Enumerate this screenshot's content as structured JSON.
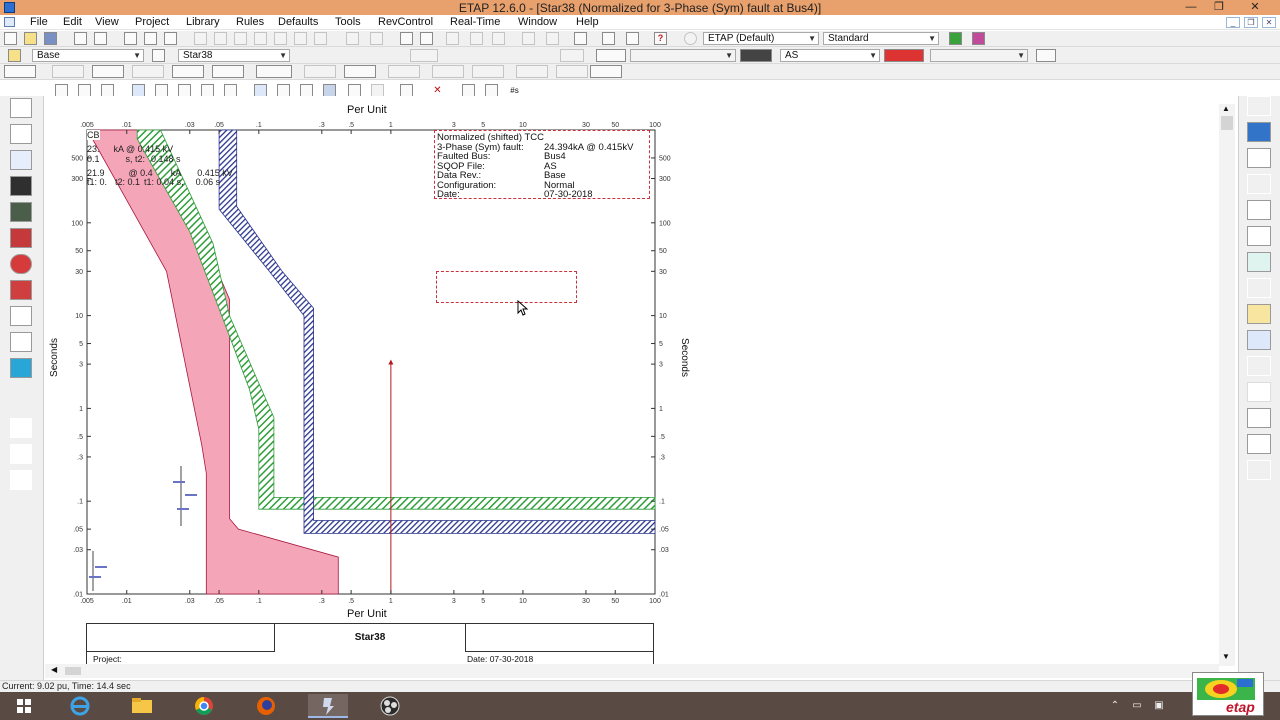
{
  "window": {
    "title": "ETAP 12.6.0 - [Star38 (Normalized for 3-Phase (Sym) fault at Bus4)]",
    "minimize": "—",
    "restore": "❐",
    "close": "✕"
  },
  "menu": {
    "items": [
      "File",
      "Edit",
      "View",
      "Project",
      "Library",
      "Rules",
      "Defaults",
      "Tools",
      "RevControl",
      "Real-Time",
      "Window",
      "Help"
    ]
  },
  "toolbar1": {
    "etap_combo": "ETAP (Default)",
    "standard_combo": "Standard"
  },
  "toolbar2": {
    "presentation_combo": "Base",
    "view_combo": "Star38",
    "bus_combo": "AS"
  },
  "plot": {
    "top_axis_label": "Per Unit",
    "bottom_axis_label": "Per Unit",
    "left_axis_label": "Seconds",
    "right_axis_label": "Seconds",
    "x_ticks": [
      ".005",
      ".01",
      ".03",
      ".05",
      ".1",
      ".3",
      ".5",
      "1",
      "3",
      "5",
      "10",
      "30",
      "50",
      "100"
    ],
    "y_ticks_left": [
      "500",
      "300",
      "100",
      "50",
      "30",
      "10",
      "5",
      "3",
      "1",
      ".5",
      ".3",
      ".1",
      ".05",
      ".03",
      ".01"
    ],
    "y_ticks_right": [
      "500",
      "300",
      "100",
      "50",
      "30",
      "10",
      "5",
      "3",
      "1",
      ".5",
      ".3",
      ".1",
      ".05",
      ".03",
      ".01"
    ],
    "colors": {
      "pink_band": "#f4a5b8",
      "pink_edge": "#a8163f",
      "green_band": "#2f9e3a",
      "blue_band": "#29348c",
      "fault_line": "#b4191e",
      "info_border": "#c8323c"
    },
    "overlay_text": {
      "line1": "CB",
      "line2": "23.",
      "line2b": "kA @ 0.415 kV",
      "line3": "0.1",
      "line3b": "s, t2:",
      "line3c": "0.148 s",
      "line4": "21.9",
      "line4b": "@ 0.4",
      "line4c": "kA",
      "line4d": "0.415 kV",
      "line5": "t1: 0.",
      "line5b": "t2: 0.1",
      "line5c": "t1: 0.04 s,",
      "line5d": "0.06 s"
    },
    "info_box": {
      "heading": "Normalized (shifted) TCC",
      "rows": [
        {
          "label": "3-Phase (Sym) fault:",
          "value": "24.394kA @ 0.415kV"
        },
        {
          "label": "Faulted Bus:",
          "value": "Bus4"
        },
        {
          "label": "SQOP File:",
          "value": "AS"
        },
        {
          "label": "Data Rev.:",
          "value": "Base"
        },
        {
          "label": "Configuration:",
          "value": "Normal"
        },
        {
          "label": "Date:",
          "value": "07-30-2018"
        }
      ]
    }
  },
  "title_block": {
    "center": "Star38",
    "project_label": "Project:",
    "date_label": "Date:",
    "date_value": "07-30-2018"
  },
  "status_bar": {
    "text": "Current: 9.02 pu,  Time: 14.4 sec"
  },
  "taskbar": {
    "apps": [
      "windows-start",
      "internet-explorer",
      "file-explorer",
      "chrome",
      "firefox",
      "etap",
      "obs"
    ]
  },
  "logo": {
    "text": "etap"
  }
}
